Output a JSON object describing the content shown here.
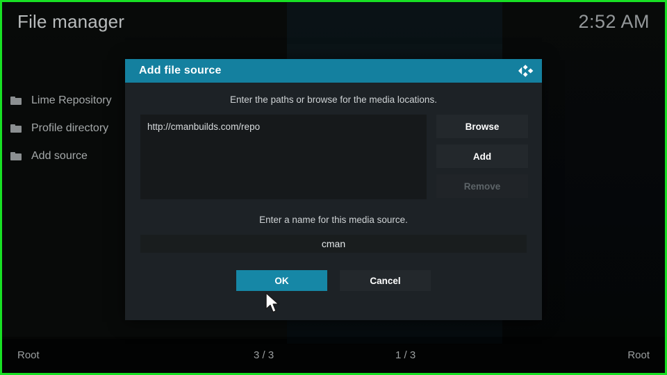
{
  "window": {
    "title": "File manager",
    "clock": "2:52 AM",
    "accent_color": "#14809f",
    "frame_color": "#18e024"
  },
  "sidebar": {
    "items": [
      {
        "label": "Lime Repository",
        "icon": "folder-icon"
      },
      {
        "label": "Profile directory",
        "icon": "folder-icon"
      },
      {
        "label": "Add source",
        "icon": "folder-icon"
      }
    ]
  },
  "statusbar": {
    "left_label": "Root",
    "left_count": "3 / 3",
    "right_count": "1 / 3",
    "right_label": "Root"
  },
  "dialog": {
    "title": "Add file source",
    "logo_icon": "kodi-logo-icon",
    "hint_paths": "Enter the paths or browse for the media locations.",
    "paths": [
      "http://cmanbuilds.com/repo"
    ],
    "buttons": {
      "browse": "Browse",
      "add": "Add",
      "remove": "Remove",
      "remove_enabled": false
    },
    "hint_name": "Enter a name for this media source.",
    "name_value": "cman",
    "actions": {
      "ok": "OK",
      "cancel": "Cancel",
      "focused": "ok"
    }
  }
}
